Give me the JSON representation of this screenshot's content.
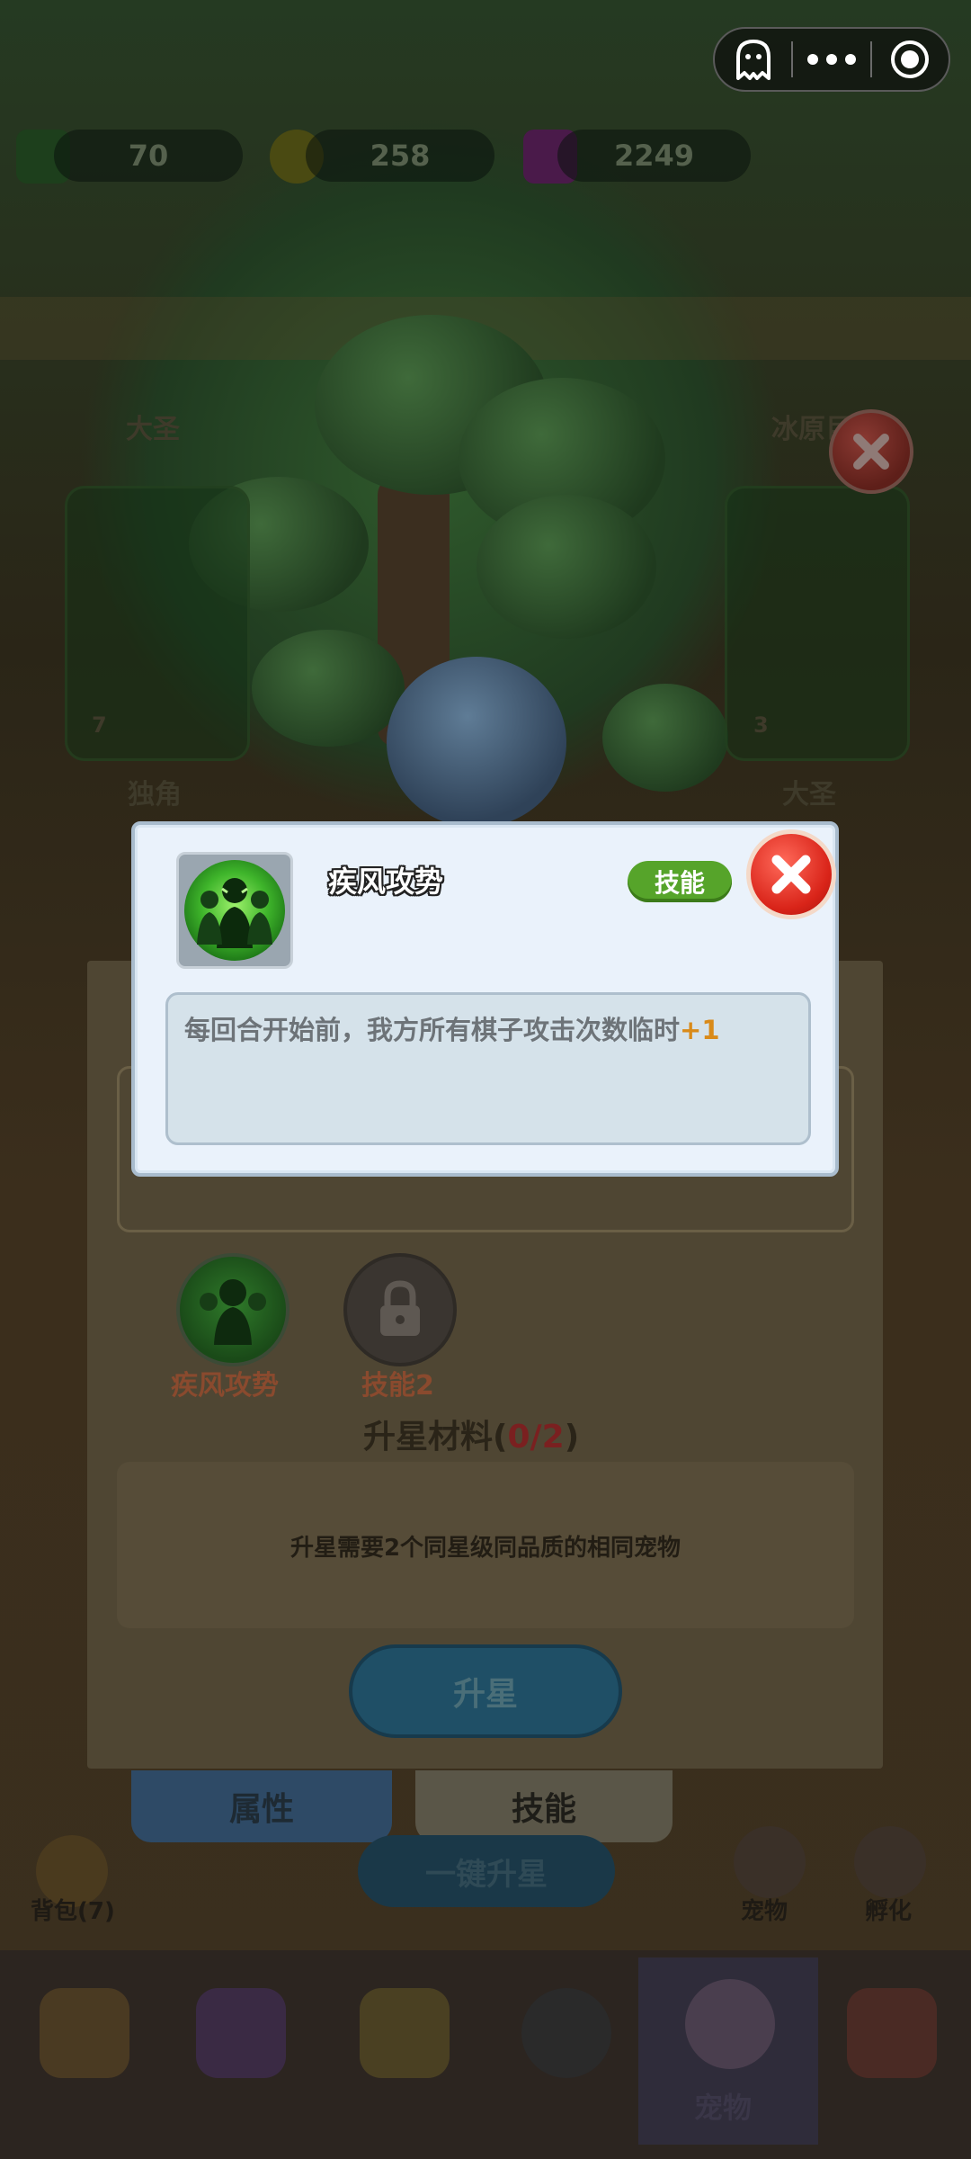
{
  "resources": {
    "leaf_count": "70",
    "star_count": "258",
    "gem_count": "2249"
  },
  "pets": {
    "top_left_name": "大圣",
    "top_right_name": "冰原巨",
    "mid_left_name": "独角",
    "mid_right_name": "大圣",
    "mid_left_level": "7",
    "mid_right_level": "3"
  },
  "modal": {
    "skill_name": "疾风攻势",
    "tag": "技能",
    "description": "每回合开始前，我方所有棋子攻击次数临时",
    "bonus": "+1"
  },
  "detail_panel": {
    "skill1_label": "疾风攻势",
    "skill2_label": "技能2",
    "materials_label": "升星材料",
    "materials_open": "(",
    "materials_count": "0/2",
    "materials_close": ")",
    "requirement_text": "升星需要2个同星级同品质的相同宠物",
    "upgrade_button": "升星"
  },
  "tabs": {
    "attributes": "属性",
    "skills": "技能"
  },
  "footer": {
    "one_click_upgrade": "一键升星",
    "backpack": "背包(7)",
    "pet": "宠物",
    "hatch": "孵化",
    "nav_active_label": "宠物"
  },
  "colors": {
    "accent_green": "#56a42a",
    "close_red": "#d92419",
    "bonus_orange": "#d98a19",
    "count_red": "#b22a2a"
  }
}
